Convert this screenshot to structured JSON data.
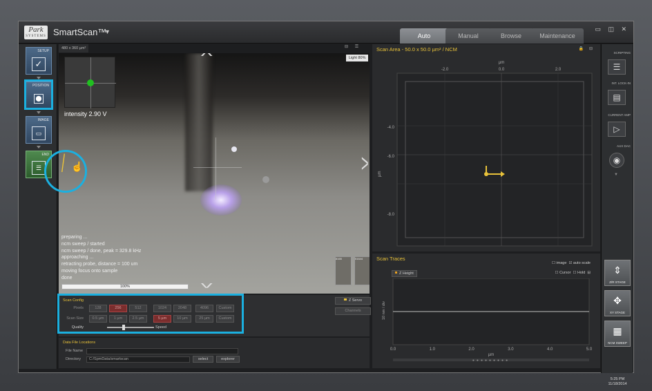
{
  "app": {
    "logo_text": "Park",
    "logo_sub": "SYSTEMS",
    "title": "SmartScan™",
    "tabs": [
      "Auto",
      "Manual",
      "Browse",
      "Maintenance"
    ],
    "active_tab": "Auto"
  },
  "left_nav": {
    "items": [
      {
        "label": "SETUP",
        "icon": "check-icon"
      },
      {
        "label": "POSITION",
        "icon": "pin-icon"
      },
      {
        "label": "IMAGE",
        "icon": "image-icon"
      },
      {
        "label": "END",
        "icon": "end-icon"
      }
    ]
  },
  "camera": {
    "size_label": "480 x 360 µm²",
    "light_label": "Light 80%",
    "intensity_label": "intensity  2.90 V",
    "log": [
      "preparing ...",
      "ncm sweep / started",
      "ncm sweep / done, peak = 329.8 kHz",
      "approaching ...",
      "retracting probe, distance = 100 um",
      "moving focus onto sample",
      "done"
    ],
    "progress_text": "100%",
    "progress": 1.0,
    "thumbs": [
      "8165",
      "51644"
    ]
  },
  "scan_config": {
    "title": "Scan Config",
    "pixels_label": "Pixels",
    "pixels_options": [
      "128",
      "256",
      "512",
      "1024",
      "2048",
      "4096",
      "Custom"
    ],
    "pixels_selected": "256",
    "scan_size_label": "Scan Size",
    "scan_size_options": [
      "0.5 µm",
      "1 µm",
      "2.5 µm",
      "5 µm",
      "10 µm",
      "25 µm",
      "Custom"
    ],
    "scan_size_selected": "5 µm",
    "quality_label": "Quality",
    "speed_label": "Speed",
    "quality_speed": 0.35,
    "zservo_label": "Z Servo",
    "channels_label": "Channels"
  },
  "data_file": {
    "title": "Data File Locations",
    "file_name_label": "File Name",
    "file_name_value": "",
    "directory_label": "Directory",
    "directory_value": "C:/SpmData/smartscan",
    "select_label": "select",
    "explorer_label": "explorer"
  },
  "scan_area": {
    "title": "Scan Area -  50.0 x 50.0 µm²  /   NCM",
    "x_unit": "µm",
    "y_unit": "µm",
    "x_ticks": [
      "-2.0",
      "0.0",
      "2.0"
    ],
    "y_ticks": [
      "-4.0",
      "-6.0",
      "-8.0"
    ],
    "accent_color": "#e8c23a"
  },
  "scan_traces": {
    "title": "Scan Traces",
    "image_label": "image",
    "auto_scale_label": "auto scale",
    "cursor_label": "Cursor",
    "hold_label": "Hold",
    "series_label": "Z Height",
    "y_label": "10 nm / div",
    "x_label": "µm",
    "x_ticks": [
      "0.0",
      "1.0",
      "2.0",
      "3.0",
      "4.0",
      "5.0"
    ]
  },
  "right_nav": {
    "items": [
      {
        "label": "SCRIPTING",
        "icon": "script-icon"
      },
      {
        "label": "INT. LOCK-IN",
        "icon": "lockin-icon"
      },
      {
        "label": "CURRENT AMP",
        "icon": "amp-icon"
      },
      {
        "label": "AUX DAC",
        "icon": "dial-icon"
      }
    ],
    "stages": [
      {
        "label": "Z/R STAGE",
        "icon": "z-stage-icon"
      },
      {
        "label": "XY STAGE",
        "icon": "xy-stage-icon"
      },
      {
        "label": "NCM SWEEP",
        "icon": "sweep-icon"
      }
    ],
    "time": "5:25 PM",
    "date": "11/18/2014"
  }
}
